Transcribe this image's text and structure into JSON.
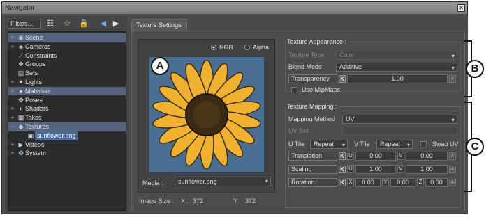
{
  "window": {
    "title": "Navigator",
    "close_label": "×"
  },
  "toolbar": {
    "filters_label": "Filters..."
  },
  "tree": {
    "nodes": [
      {
        "label": "Scene",
        "expander": "+",
        "icon": "scene-icon",
        "selected": true
      },
      {
        "label": "Cameras",
        "expander": "+",
        "icon": "camera-icon"
      },
      {
        "label": "Constraints",
        "expander": "",
        "icon": "constraint-icon"
      },
      {
        "label": "Groups",
        "expander": "",
        "icon": "group-icon"
      },
      {
        "label": "Sets",
        "expander": "",
        "icon": "set-icon"
      },
      {
        "label": "Lights",
        "expander": "+",
        "icon": "light-icon"
      },
      {
        "label": "Materials",
        "expander": "+",
        "icon": "material-icon",
        "selected": true
      },
      {
        "label": "Poses",
        "expander": "",
        "icon": "pose-icon"
      },
      {
        "label": "Shaders",
        "expander": "+",
        "icon": "shader-icon"
      },
      {
        "label": "Takes",
        "expander": "+",
        "icon": "take-icon"
      },
      {
        "label": "Textures",
        "expander": "−",
        "icon": "texture-icon",
        "selected": true
      },
      {
        "label": "sunflower.png",
        "expander": "",
        "icon": "image-icon",
        "child": true
      },
      {
        "label": "Videos",
        "expander": "+",
        "icon": "video-icon"
      },
      {
        "label": "System",
        "expander": "+",
        "icon": "system-icon"
      }
    ]
  },
  "tab": {
    "label": "Texture Settings"
  },
  "preview": {
    "rgb_label": "RGB",
    "alpha_label": "Alpha",
    "media_label": "Media :",
    "media_value": "sunflower.png",
    "image_size_label": "Image Size :",
    "x_label": "X :",
    "x_value": "372",
    "y_label": "Y :",
    "y_value": "372"
  },
  "appearance": {
    "title": "Texture Appearance :",
    "texture_type_label": "Texture Type",
    "texture_type_value": "Color",
    "blend_mode_label": "Blend Mode",
    "blend_mode_value": "Additive",
    "transparency_label": "Transparency",
    "transparency_value": "1.00",
    "use_mipmaps_label": "Use MipMaps"
  },
  "mapping": {
    "title": "Texture Mapping :",
    "mapping_method_label": "Mapping Method",
    "mapping_method_value": "UV",
    "uv_set_label": "UV Set",
    "u_tile_label": "U Tile",
    "u_tile_value": "Repeat",
    "v_tile_label": "V Tile",
    "v_tile_value": "Repeat",
    "swap_uv_label": "Swap UV",
    "translation_label": "Translation",
    "translation_u": "0.00",
    "translation_v": "0.00",
    "scaling_label": "Scaling",
    "scaling_u": "1.00",
    "scaling_v": "1.00",
    "rotation_label": "Rotation",
    "rotation_x": "0.00",
    "rotation_y": "0.00",
    "rotation_z": "0.00"
  },
  "glyphs": {
    "k": "K",
    "u": "U",
    "v": "V",
    "x": "X",
    "y": "Y",
    "z": "Z",
    "a": "A"
  },
  "callouts": {
    "a": "A",
    "b": "B",
    "c": "C"
  }
}
